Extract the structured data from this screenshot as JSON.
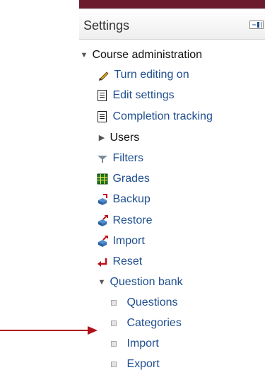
{
  "block": {
    "title": "Settings",
    "dock_icon": "dock-icon"
  },
  "tree": {
    "course_admin": "Course administration",
    "items": {
      "turn_editing_on": "Turn editing on",
      "edit_settings": "Edit settings",
      "completion_tracking": "Completion tracking",
      "users": "Users",
      "filters": "Filters",
      "grades": "Grades",
      "backup": "Backup",
      "restore": "Restore",
      "import": "Import",
      "reset": "Reset",
      "question_bank": "Question bank"
    },
    "question_bank_items": {
      "questions": "Questions",
      "categories": "Categories",
      "import": "Import",
      "export": "Export"
    }
  },
  "colors": {
    "topbar": "#6b1b2c",
    "link": "#1f4f8f",
    "annotation_arrow": "#b0101a"
  }
}
